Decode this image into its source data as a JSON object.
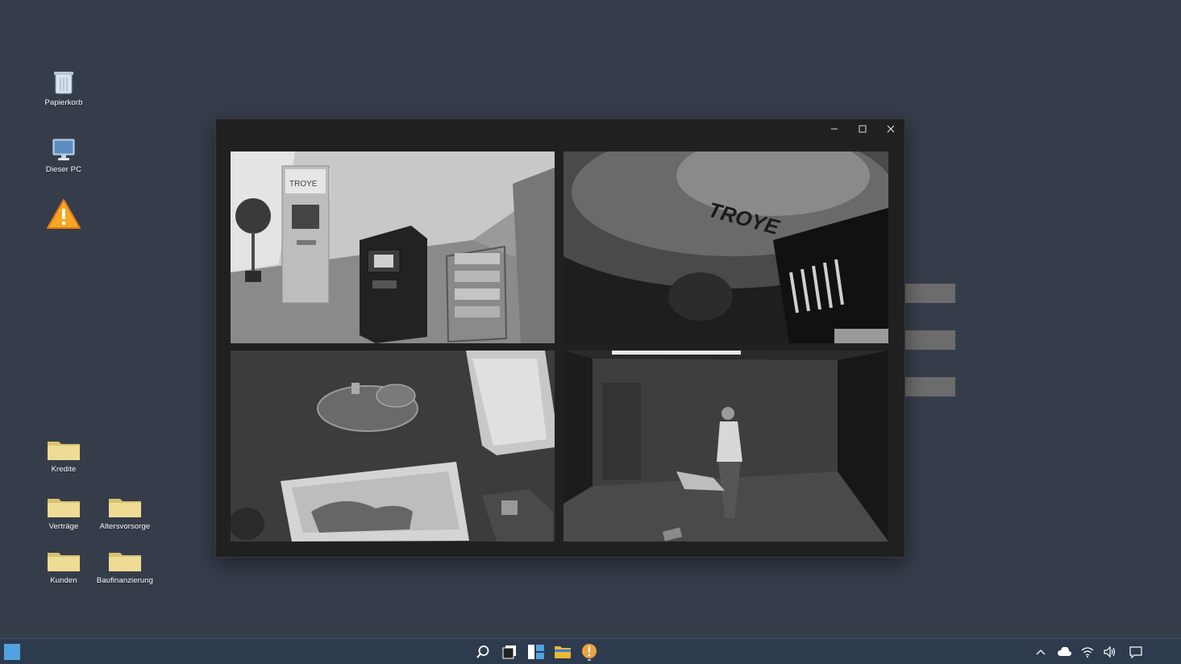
{
  "desktop": {
    "icons": [
      {
        "id": "recycle",
        "label": "Papierkorb"
      },
      {
        "id": "pc",
        "label": "Dieser PC"
      },
      {
        "id": "warning",
        "label": ""
      },
      {
        "id": "kredite",
        "label": "Kredite"
      },
      {
        "id": "vertraege",
        "label": "Verträge"
      },
      {
        "id": "altersvorsorge",
        "label": "Altersvorsorge"
      },
      {
        "id": "kunden",
        "label": "Kunden"
      },
      {
        "id": "baufinanzierung",
        "label": "Baufinanzierung"
      }
    ]
  },
  "window": {
    "title": "",
    "controls": {
      "minimize": "minimize-icon",
      "maximize": "maximize-icon",
      "close": "close-icon"
    },
    "feeds": [
      {
        "id": "cam-1",
        "scene": "atm-lobby",
        "sign_text": "TROYE"
      },
      {
        "id": "cam-2",
        "scene": "ceiling-logo",
        "sign_text": "TROYE"
      },
      {
        "id": "cam-3",
        "scene": "lounge"
      },
      {
        "id": "cam-4",
        "scene": "back-room"
      }
    ]
  },
  "taskbar": {
    "items": [
      "start-icon",
      "search-icon",
      "task-view-icon",
      "widgets-icon",
      "file-explorer-icon",
      "warning-app-icon"
    ],
    "tray": [
      "chevron-up-icon",
      "cloud-icon",
      "wifi-icon",
      "volume-icon",
      "notification-icon"
    ]
  },
  "colors": {
    "desktop_bg": "#363d4a",
    "taskbar_bg": "#2e3a4d",
    "window_bg": "#202020",
    "folder": "#e8d58a",
    "warning": "#f5a623"
  }
}
